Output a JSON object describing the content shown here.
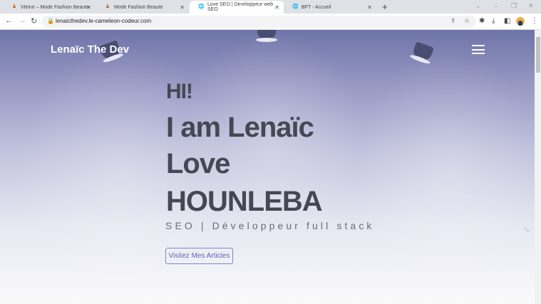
{
  "browser": {
    "tabs": [
      {
        "title": "Vitrine – Mode Fashion Beaute",
        "active": false
      },
      {
        "title": "Mode Fashion Beaute",
        "active": false
      },
      {
        "title": "Love SEO | Developpeur web SEO",
        "active": true
      },
      {
        "title": "BFT - Accueil",
        "active": false
      }
    ],
    "url": "lenaicthedev.le-cameleon-codeur.com"
  },
  "site": {
    "logo": "Lenaïc The Dev",
    "hero": {
      "greeting": "HI!",
      "line1": "I am Lenaïc",
      "line2": "Love",
      "line3": "HOUNLEBA",
      "subtitle": "SEO | Développeur full stack",
      "cta": "Visitez Mes Articles"
    }
  },
  "colors": {
    "accent": "#6a5fb0",
    "heading": "#454852"
  }
}
